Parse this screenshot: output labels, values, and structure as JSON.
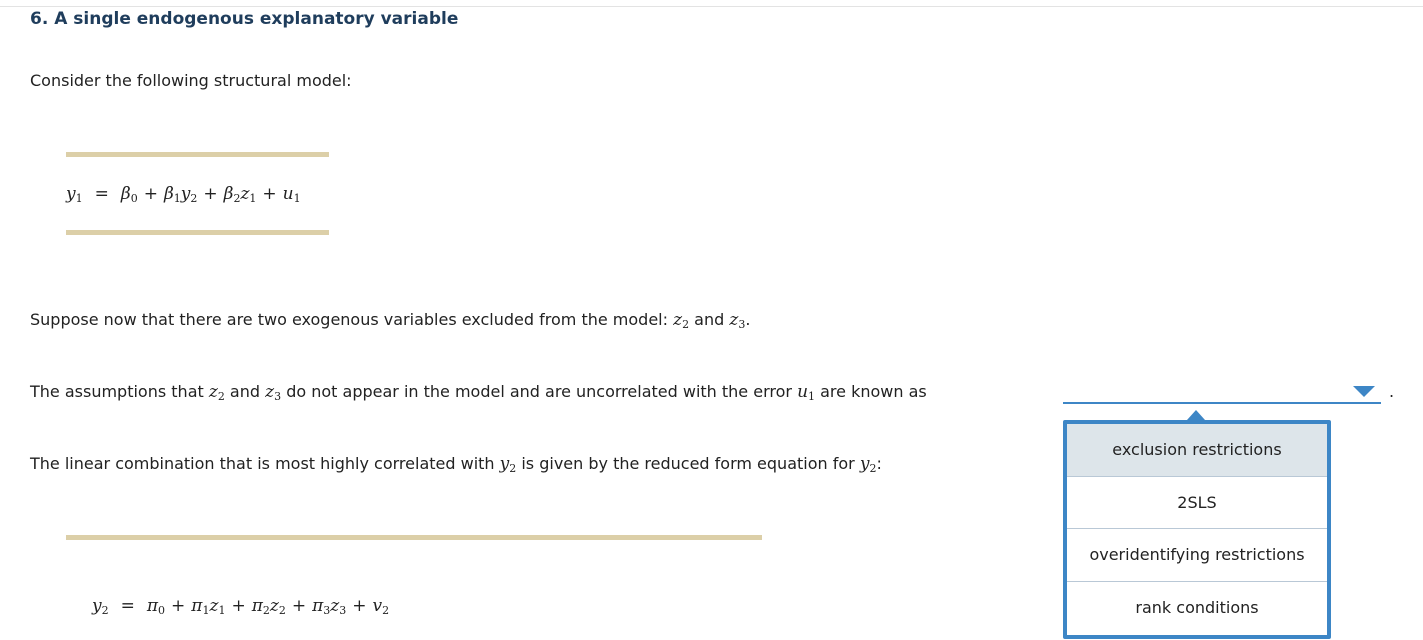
{
  "heading": "6. A single endogenous explanatory variable",
  "intro": "Consider the following structural model:",
  "structural_eq": {
    "lhs_var": "y",
    "lhs_sub": "1",
    "beta": "β",
    "terms": [
      "0",
      "1",
      "y",
      "2",
      "2",
      "z",
      "1",
      "u",
      "1"
    ]
  },
  "suppose_text": "Suppose now that there are two exogenous variables excluded from the model:",
  "and_word": "and",
  "assumption_text_a": "The assumptions that",
  "assumption_text_b": "do not appear in the model and are uncorrelated with the error",
  "assumption_text_c": "are known as",
  "linear_text": "The linear combination that is most highly correlated with",
  "linear_text_b": "is given by the reduced form equation for",
  "dropdown": {
    "selected": "",
    "options": [
      "exclusion restrictions",
      "2SLS",
      "overidentifying restrictions",
      "rank conditions"
    ],
    "highlighted_index": 0
  },
  "colors": {
    "accent": "#3d86c6",
    "rule": "#dccfa8",
    "heading": "#1f3d5c"
  }
}
